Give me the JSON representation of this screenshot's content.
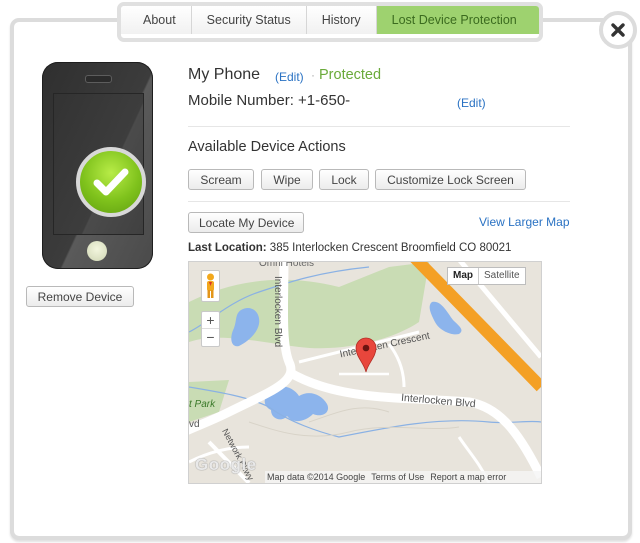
{
  "tabs": [
    {
      "label": "About",
      "active": false
    },
    {
      "label": "Security Status",
      "active": false
    },
    {
      "label": "History",
      "active": false
    },
    {
      "label": "Lost Device Protection",
      "active": true
    }
  ],
  "close_icon": "close-x-icon",
  "device": {
    "name": "My Phone",
    "edit_label": "(Edit)",
    "separator": "·",
    "status": "Protected",
    "mobile_label": "Mobile Number: +1-650-",
    "mobile_edit_label": "(Edit)",
    "image_icon": "phone-checkmark-icon",
    "remove_button": "Remove Device"
  },
  "actions": {
    "heading": "Available Device Actions",
    "buttons": [
      "Scream",
      "Wipe",
      "Lock",
      "Customize Lock Screen"
    ]
  },
  "locate": {
    "button": "Locate My Device",
    "larger_map_link": "View Larger Map",
    "last_location_label": "Last Location:",
    "last_location_value": "385 Interlocken Crescent Broomfield CO 80021"
  },
  "map": {
    "map_type_options": [
      "Map",
      "Satellite"
    ],
    "selected_map_type": "Map",
    "zoom_in": "+",
    "zoom_out": "−",
    "labels": {
      "blvd_vertical": "Interlocken Blvd",
      "blvd_horizontal": "Interlocken Blvd",
      "crescent": "Interlocken Crescent",
      "park": "t Park",
      "network": "Network Pkwy",
      "top": "Omni Hotels",
      "vd": "vd"
    },
    "logo": "Google",
    "attribution": [
      "Map data ©2014 Google",
      "Terms of Use",
      "Report a map error"
    ]
  },
  "colors": {
    "active_tab": "#9ed26f",
    "protected": "#6aaa3a",
    "link": "#2a72c3"
  }
}
